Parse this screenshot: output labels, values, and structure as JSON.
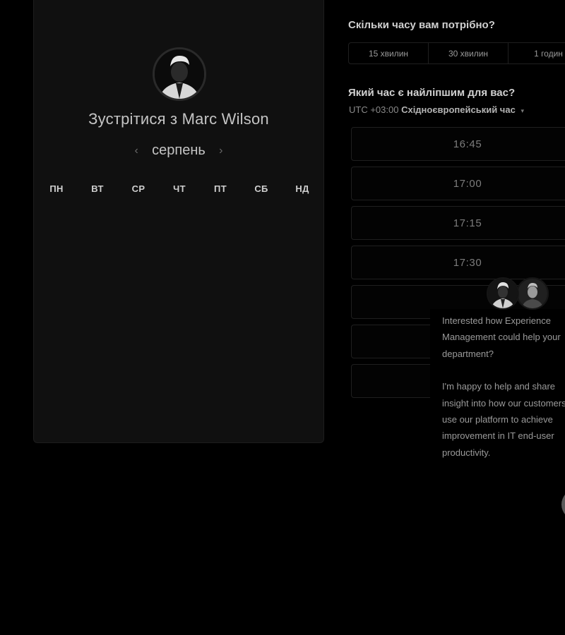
{
  "calendar": {
    "title": "Зустрітися з Marc Wilson",
    "month": "серпень",
    "prev_icon": "chevron-left-icon",
    "next_icon": "chevron-right-icon",
    "weekdays": [
      "ПН",
      "ВТ",
      "СР",
      "ЧТ",
      "ПТ",
      "СБ",
      "НД"
    ]
  },
  "duration": {
    "question": "Скільки часу вам потрібно?",
    "options": [
      "15 хвилин",
      "30 хвилин",
      "1 годин"
    ]
  },
  "time": {
    "question": "Який час є найліпшим для вас?",
    "tz_offset": "UTC +03:00",
    "tz_name": "Східноєвропейський час",
    "tz_caret_icon": "caret-down-icon",
    "slots": [
      "16:45",
      "17:00",
      "17:15",
      "17:30",
      "",
      "",
      "",
      ""
    ]
  },
  "chat": {
    "paragraphs": [
      "Interested how Experience Management could help your department?",
      "I'm happy to help and share insight into how our customers use our platform to achieve improvement in IT end-user productivity."
    ]
  },
  "colors": {
    "background": "#000000",
    "panel": "#101010",
    "text_primary": "#c4c4c4",
    "text_muted": "#7c7c7c"
  }
}
